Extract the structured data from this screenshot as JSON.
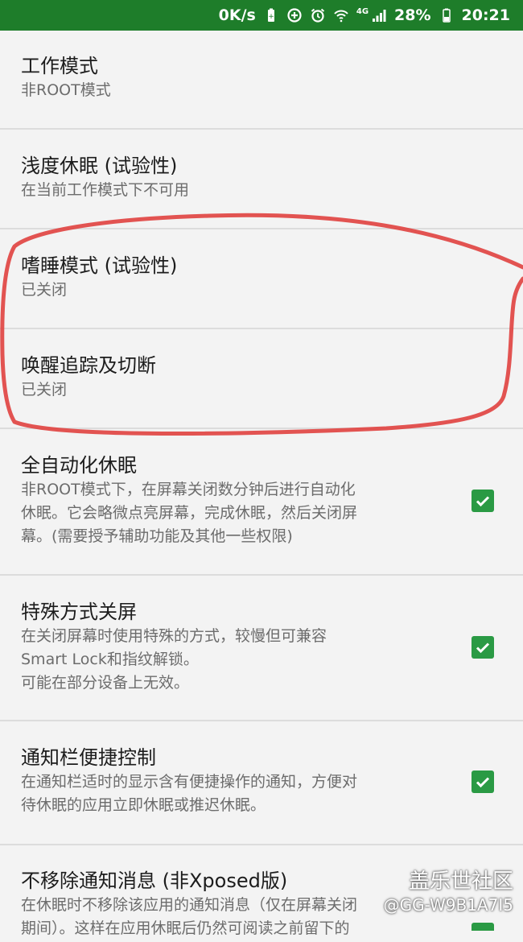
{
  "status_bar": {
    "speed": "0K/s",
    "network": "4G",
    "battery": "28%",
    "time": "20:21"
  },
  "preferences": [
    {
      "title": "工作模式",
      "summary": "非ROOT模式",
      "checked": false
    },
    {
      "title": "浅度休眠 (试验性)",
      "summary": "在当前工作模式下不可用",
      "checked": false
    },
    {
      "title": "嗜睡模式 (试验性)",
      "summary": "已关闭",
      "checked": false
    },
    {
      "title": "唤醒追踪及切断",
      "summary": "已关闭",
      "checked": false
    },
    {
      "title": "全自动化休眠",
      "summary": "非ROOT模式下，在屏幕关闭数分钟后进行自动化\n休眠。它会略微点亮屏幕，完成休眠，然后关闭屏\n幕。(需要授予辅助功能及其他一些权限)",
      "checked": true
    },
    {
      "title": "特殊方式关屏",
      "summary": "在关闭屏幕时使用特殊的方式，较慢但可兼容\nSmart Lock和指纹解锁。\n可能在部分设备上无效。",
      "checked": true
    },
    {
      "title": "通知栏便捷控制",
      "summary": "在通知栏适时的显示含有便捷操作的通知，方便对\n待休眠的应用立即休眠或推迟休眠。",
      "checked": true
    },
    {
      "title": "不移除通知消息 (非Xposed版)",
      "summary": "在休眠时不移除该应用的通知消息（仅在屏幕关闭\n期间）。这样在应用休眠后仍然可阅读之前留下的",
      "checked": false
    }
  ],
  "watermark": {
    "main": "盖乐世社区",
    "sub": "@GG-W9B1A7I5"
  },
  "colors": {
    "status_bar": "#1e7d2a",
    "checkbox": "#2a9a44",
    "annotation": "#e0413f"
  }
}
